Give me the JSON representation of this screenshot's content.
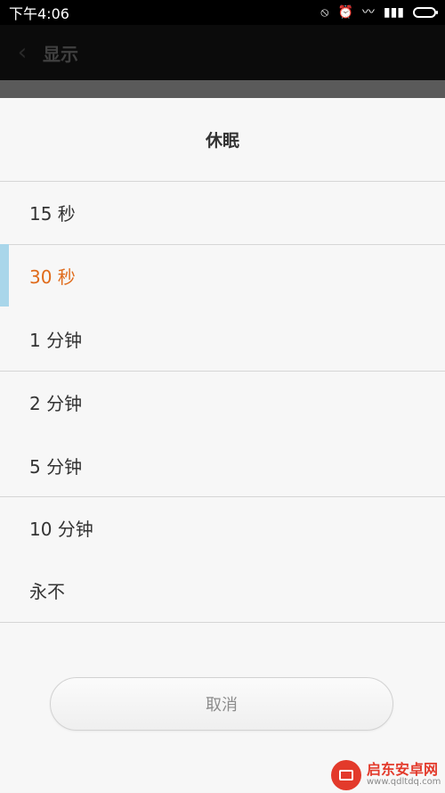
{
  "status_bar": {
    "time": "下午4:06",
    "icons": [
      "vibrate-off-icon",
      "alarm-icon",
      "wifi-icon",
      "signal-icon",
      "battery-icon"
    ]
  },
  "app_bar": {
    "back_icon": "chevron-left-icon",
    "title": "显示"
  },
  "dialog": {
    "title": "休眠",
    "options": [
      {
        "label": "15 秒",
        "selected": false
      },
      {
        "label": "30 秒",
        "selected": true
      },
      {
        "label": "1 分钟",
        "selected": false
      },
      {
        "label": "2 分钟",
        "selected": false
      },
      {
        "label": "5 分钟",
        "selected": false
      },
      {
        "label": "10 分钟",
        "selected": false
      },
      {
        "label": "永不",
        "selected": false
      }
    ],
    "cancel_label": "取消",
    "selected_color": "#e06b1b",
    "selected_bar_color": "#a9d6ea"
  },
  "watermark": {
    "brand": "启东安卓网",
    "url": "www.qdltdq.com"
  }
}
